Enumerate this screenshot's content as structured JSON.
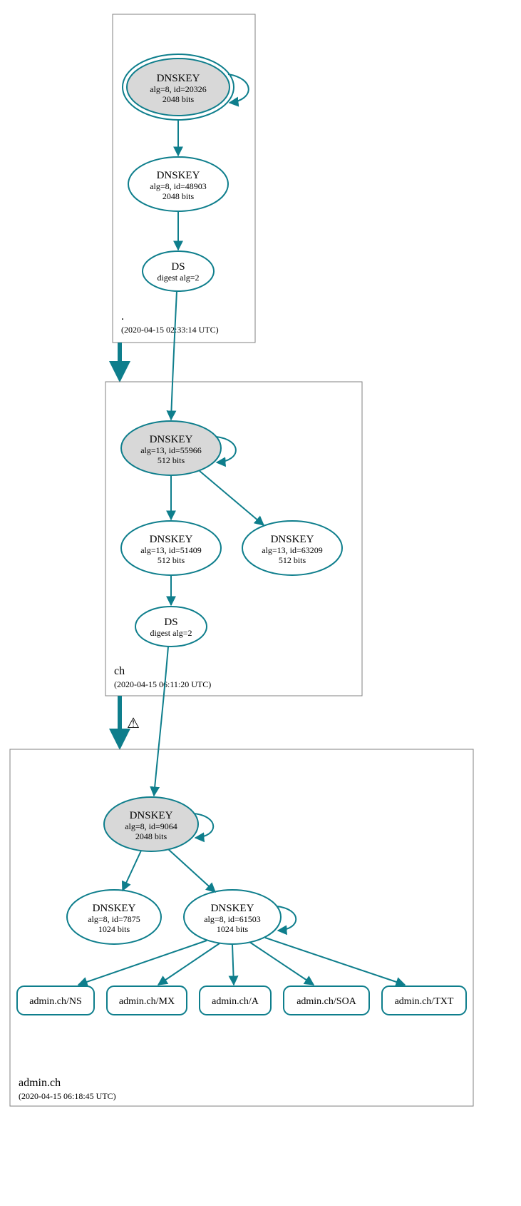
{
  "zones": {
    "root": {
      "name": ".",
      "timestamp": "(2020-04-15 02:33:14 UTC)",
      "nodes": {
        "ksk": {
          "title": "DNSKEY",
          "line2": "alg=8, id=20326",
          "line3": "2048 bits"
        },
        "zsk": {
          "title": "DNSKEY",
          "line2": "alg=8, id=48903",
          "line3": "2048 bits"
        },
        "ds": {
          "title": "DS",
          "line2": "digest alg=2"
        }
      }
    },
    "ch": {
      "name": "ch",
      "timestamp": "(2020-04-15 06:11:20 UTC)",
      "nodes": {
        "ksk": {
          "title": "DNSKEY",
          "line2": "alg=13, id=55966",
          "line3": "512 bits"
        },
        "zsk1": {
          "title": "DNSKEY",
          "line2": "alg=13, id=51409",
          "line3": "512 bits"
        },
        "zsk2": {
          "title": "DNSKEY",
          "line2": "alg=13, id=63209",
          "line3": "512 bits"
        },
        "ds": {
          "title": "DS",
          "line2": "digest alg=2"
        }
      }
    },
    "admin": {
      "name": "admin.ch",
      "timestamp": "(2020-04-15 06:18:45 UTC)",
      "nodes": {
        "ksk": {
          "title": "DNSKEY",
          "line2": "alg=8, id=9064",
          "line3": "2048 bits"
        },
        "zsk1": {
          "title": "DNSKEY",
          "line2": "alg=8, id=7875",
          "line3": "1024 bits"
        },
        "zsk2": {
          "title": "DNSKEY",
          "line2": "alg=8, id=61503",
          "line3": "1024 bits"
        }
      },
      "rrsets": {
        "ns": "admin.ch/NS",
        "mx": "admin.ch/MX",
        "a": "admin.ch/A",
        "soa": "admin.ch/SOA",
        "txt": "admin.ch/TXT"
      }
    }
  },
  "warning_glyph": "⚠"
}
